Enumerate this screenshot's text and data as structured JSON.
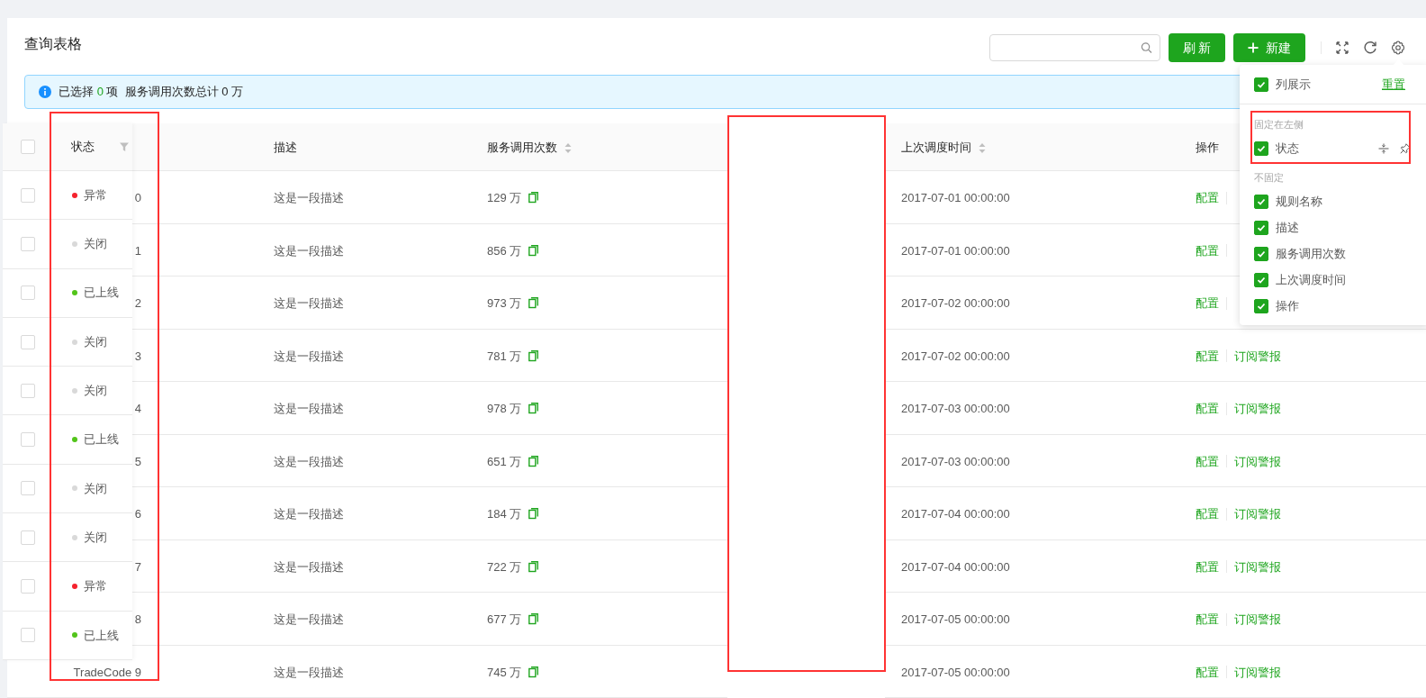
{
  "page": {
    "title": "查询表格"
  },
  "toolbar": {
    "buttons": [
      {
        "kind": "refresh",
        "label": "刷 新"
      },
      {
        "kind": "create",
        "label": "新建"
      }
    ]
  },
  "alert": {
    "prefix": "已选择",
    "count": "0",
    "suffix": "项",
    "summary": "服务调用次数总计 0 万"
  },
  "fixed_column": {
    "title": "状态",
    "header_checked": false,
    "rows": [
      {
        "label": "异常",
        "color": "#f5222d",
        "checked": false
      },
      {
        "label": "关闭",
        "color": "#d9d9d9",
        "checked": false
      },
      {
        "label": "已上线",
        "color": "#52c41a",
        "checked": false
      },
      {
        "label": "关闭",
        "color": "#d9d9d9",
        "checked": false
      },
      {
        "label": "关闭",
        "color": "#d9d9d9",
        "checked": false
      },
      {
        "label": "已上线",
        "color": "#52c41a",
        "checked": false
      },
      {
        "label": "关闭",
        "color": "#d9d9d9",
        "checked": false
      },
      {
        "label": "关闭",
        "color": "#d9d9d9",
        "checked": false
      },
      {
        "label": "异常",
        "color": "#f5222d",
        "checked": false
      },
      {
        "label": "已上线",
        "color": "#52c41a",
        "checked": false
      }
    ]
  },
  "table": {
    "columns": [
      {
        "kind": "text",
        "title": "描述"
      },
      {
        "kind": "sortable",
        "title": "服务调用次数"
      },
      {
        "kind": "blank"
      },
      {
        "kind": "sortable",
        "title": "上次调度时间"
      },
      {
        "kind": "text",
        "title": "操作"
      }
    ],
    "rows": [
      {
        "name": "0",
        "description": "这是一段描述",
        "calls": "129 万",
        "time": "2017-07-01 00:00:00",
        "actions": [
          "配置"
        ]
      },
      {
        "name": "1",
        "description": "这是一段描述",
        "calls": "856 万",
        "time": "2017-07-01 00:00:00",
        "actions": [
          "配置"
        ]
      },
      {
        "name": "2",
        "description": "这是一段描述",
        "calls": "973 万",
        "time": "2017-07-02 00:00:00",
        "actions": [
          "配置"
        ]
      },
      {
        "name": "3",
        "description": "这是一段描述",
        "calls": "781 万",
        "time": "2017-07-02 00:00:00",
        "actions": [
          "配置",
          "订阅警报"
        ]
      },
      {
        "name": "4",
        "description": "这是一段描述",
        "calls": "978 万",
        "time": "2017-07-03 00:00:00",
        "actions": [
          "配置",
          "订阅警报"
        ]
      },
      {
        "name": "5",
        "description": "这是一段描述",
        "calls": "651 万",
        "time": "2017-07-03 00:00:00",
        "actions": [
          "配置",
          "订阅警报"
        ]
      },
      {
        "name": "6",
        "description": "这是一段描述",
        "calls": "184 万",
        "time": "2017-07-04 00:00:00",
        "actions": [
          "配置",
          "订阅警报"
        ]
      },
      {
        "name": "7",
        "description": "这是一段描述",
        "calls": "722 万",
        "time": "2017-07-04 00:00:00",
        "actions": [
          "配置",
          "订阅警报"
        ]
      },
      {
        "name": "8",
        "description": "这是一段描述",
        "calls": "677 万",
        "time": "2017-07-05 00:00:00",
        "actions": [
          "配置",
          "订阅警报"
        ]
      },
      {
        "name": "TradeCode 9",
        "description": "这是一段描述",
        "calls": "745 万",
        "time": "2017-07-05 00:00:00",
        "actions": [
          "配置",
          "订阅警报"
        ]
      }
    ]
  },
  "column_settings": {
    "title": "列展示",
    "checked": true,
    "reset": "重置",
    "groups": [
      {
        "kind": "fixed_left",
        "title": "固定在左侧",
        "items": [
          {
            "label": "状态",
            "checked": true
          }
        ]
      },
      {
        "kind": "unfixed",
        "title": "不固定",
        "items": [
          {
            "label": "规则名称",
            "checked": true
          },
          {
            "label": "描述",
            "checked": true
          },
          {
            "label": "服务调用次数",
            "checked": true
          },
          {
            "label": "上次调度时间",
            "checked": true
          },
          {
            "label": "操作",
            "checked": true
          }
        ]
      }
    ]
  }
}
